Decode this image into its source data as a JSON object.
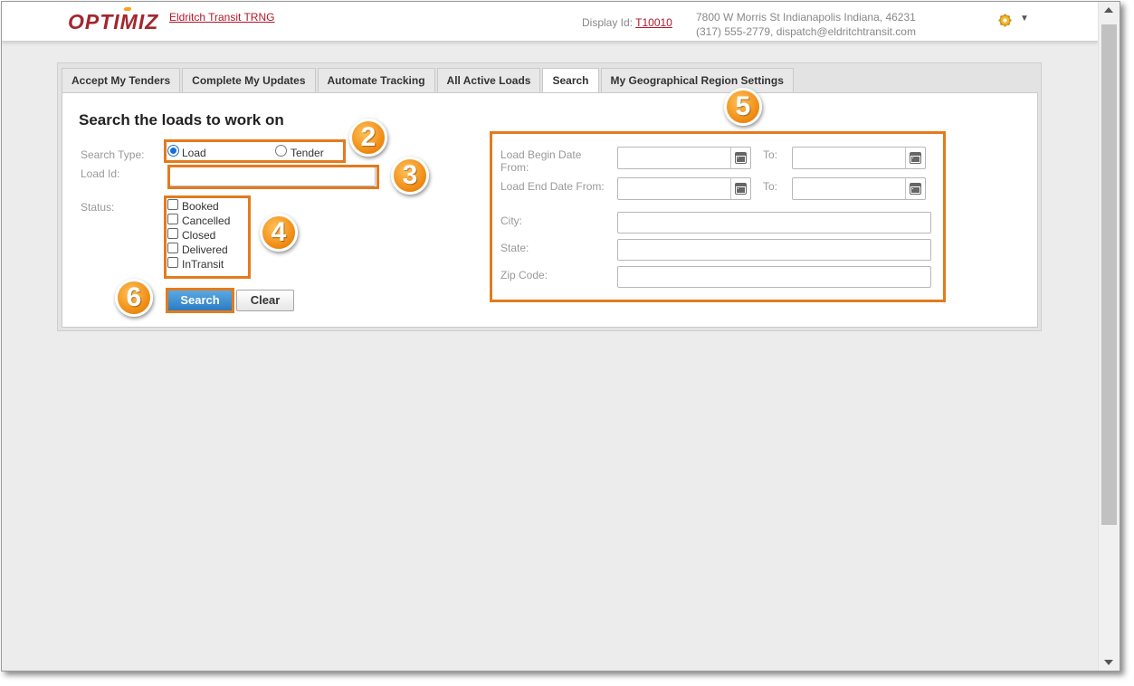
{
  "header": {
    "logo_text": "OPTIMIZ",
    "company_link": "Eldritch Transit TRNG",
    "display_id_label": "Display Id:",
    "display_id_value": "T10010",
    "address_line1": "7800 W Morris St Indianapolis Indiana, 46231",
    "address_line2": "(317) 555-2779, dispatch@eldritchtransit.com",
    "settings_icon": "gear-icon",
    "menu_icon": "caret-down-icon"
  },
  "tabs": [
    {
      "label": "Accept My Tenders",
      "active": false
    },
    {
      "label": "Complete My Updates",
      "active": false
    },
    {
      "label": "Automate Tracking",
      "active": false
    },
    {
      "label": "All Active Loads",
      "active": false
    },
    {
      "label": "Search",
      "active": true
    },
    {
      "label": "My Geographical Region Settings",
      "active": false
    }
  ],
  "form": {
    "heading": "Search the loads to work on",
    "search_type_label": "Search Type:",
    "search_type_options": [
      "Load",
      "Tender"
    ],
    "search_type_selected": "Load",
    "load_id_label": "Load Id:",
    "load_id_value": "",
    "status_label": "Status:",
    "status_options": [
      {
        "label": "Booked",
        "checked": false
      },
      {
        "label": "Cancelled",
        "checked": false
      },
      {
        "label": "Closed",
        "checked": false
      },
      {
        "label": "Delivered",
        "checked": false
      },
      {
        "label": "InTransit",
        "checked": false
      }
    ],
    "search_button": "Search",
    "clear_button": "Clear",
    "load_begin_date_label": "Load Begin Date From:",
    "load_end_date_label": "Load End Date From:",
    "to_label": "To:",
    "city_label": "City:",
    "state_label": "State:",
    "zip_label": "Zip Code:"
  },
  "callouts": [
    "2",
    "3",
    "4",
    "5",
    "6"
  ],
  "colors": {
    "brand_red": "#a3262e",
    "link_red": "#b0182a",
    "highlight_orange": "#e37b1d",
    "badge_orange": "#f08c14",
    "primary_button": "#2c7cc2"
  }
}
